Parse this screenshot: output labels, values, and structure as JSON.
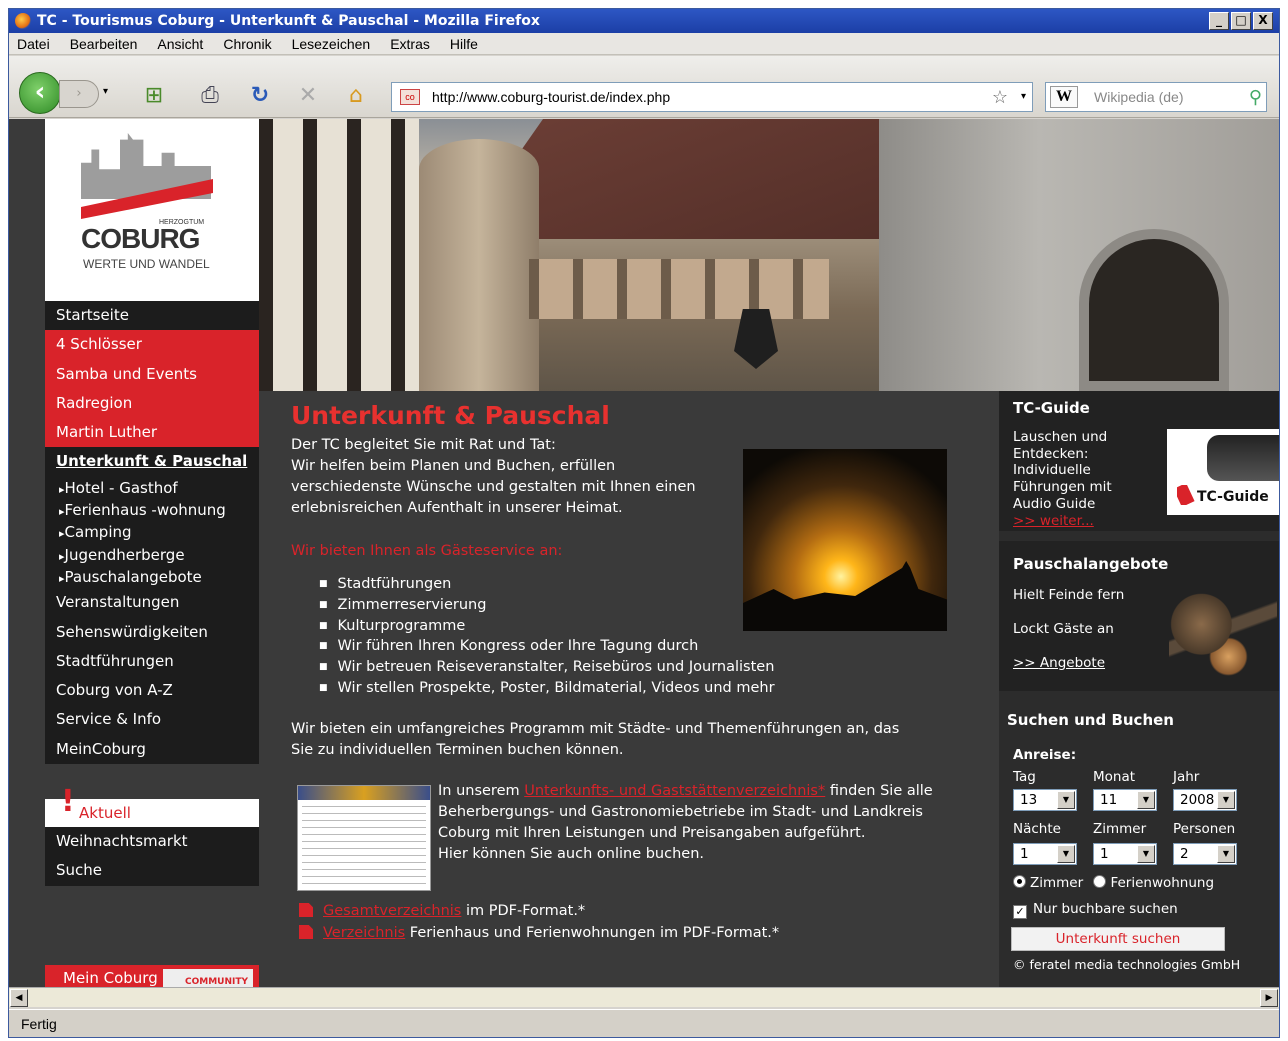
{
  "window": {
    "title": "TC - Tourismus Coburg - Unterkunft & Pauschal - Mozilla Firefox",
    "min": "_",
    "max": "□",
    "close": "X"
  },
  "menu": [
    "Datei",
    "Bearbeiten",
    "Ansicht",
    "Chronik",
    "Lesezeichen",
    "Extras",
    "Hilfe"
  ],
  "toolbar": {
    "url": "http://www.coburg-tourist.de/index.php",
    "search_engine": "W",
    "search_placeholder": "Wikipedia (de)",
    "favicon": "co"
  },
  "logo": {
    "small": "HERZOGTUM",
    "name": "COBURG",
    "tagline": "WERTE UND WANDEL"
  },
  "nav": {
    "top": [
      {
        "label": "Startseite",
        "style": "dark"
      },
      {
        "label": "4 Schlösser",
        "style": "red"
      },
      {
        "label": "Samba und Events",
        "style": "red"
      },
      {
        "label": "Radregion",
        "style": "red"
      },
      {
        "label": "Martin Luther",
        "style": "red"
      },
      {
        "label": "Unterkunft & Pauschal",
        "style": "active"
      }
    ],
    "sub": [
      "Hotel - Gasthof",
      "Ferienhaus -wohnung",
      "Camping",
      "Jugendherberge",
      "Pauschalangebote"
    ],
    "more": [
      "Veranstaltungen",
      "Sehenswürdigkeiten",
      "Stadtführungen",
      "Coburg von A-Z",
      "Service & Info",
      "MeinCoburg"
    ],
    "aktuell": "Aktuell",
    "aktuell_items": [
      "Weihnachtsmarkt",
      "Suche"
    ],
    "mein_coburg": "Mein Coburg",
    "community": "COMMUNITY"
  },
  "main": {
    "title": "Unterkunft & Pauschal",
    "intro": [
      "Der TC begleitet Sie mit Rat und Tat:",
      "Wir helfen beim Planen und Buchen, erfüllen",
      "verschiedenste Wünsche und gestalten mit Ihnen einen",
      "erlebnisreichen Aufenthalt in unserer Heimat."
    ],
    "service_heading": "Wir bieten Ihnen als Gästeservice an:",
    "services": [
      "Stadtführungen",
      "Zimmerreservierung",
      "Kulturprogramme",
      "Wir führen Ihren Kongress oder Ihre Tagung durch",
      "Wir betreuen Reiseveranstalter, Reisebüros und Journalisten",
      "Wir stellen Prospekte, Poster, Bildmaterial, Videos und mehr"
    ],
    "program": [
      "Wir bieten ein umfangreiches Programm mit Städte- und Themenführungen an, das",
      "Sie zu individuellen Terminen buchen können."
    ],
    "dir_pre": "In unserem ",
    "dir_link": "Unterkunfts- und Gaststättenverzeichnis*",
    "dir_post": " finden Sie alle",
    "dir_lines": [
      "Beherbergungs- und Gastronomiebetriebe im Stadt- und Landkreis",
      "Coburg mit Ihren Leistungen und Preisangaben aufgeführt.",
      "Hier können Sie auch online buchen."
    ],
    "pdf1_link": "Gesamtverzeichnis",
    "pdf1_text": " im PDF-Format.*",
    "pdf2_link": "Verzeichnis",
    "pdf2_text": " Ferienhaus und Ferienwohnungen im PDF-Format.*"
  },
  "sidebar": {
    "guide_title": "TC-Guide",
    "guide_text": [
      "Lauschen und",
      "Entdecken:",
      "Individuelle",
      "Führungen mit",
      "Audio Guide"
    ],
    "guide_link": ">> weiter...",
    "guide_img_label": "TC-Guide",
    "pausch_title": "Pauschalangebote",
    "pausch_l1": "Hielt Feinde fern",
    "pausch_l2": "Lockt Gäste an",
    "pausch_link": ">> Angebote",
    "search_title": "Suchen und Buchen",
    "anreise": "Anreise:",
    "tag_label": "Tag",
    "monat_label": "Monat",
    "jahr_label": "Jahr",
    "tag": "13",
    "monat": "11",
    "jahr": "2008",
    "naechte_label": "Nächte",
    "zimmer_label": "Zimmer",
    "personen_label": "Personen",
    "naechte": "1",
    "zimmer": "1",
    "personen": "2",
    "radio_zimmer": "Zimmer",
    "radio_ferien": "Ferienwohnung",
    "checkbox": "Nur buchbare suchen",
    "button": "Unterkunft suchen",
    "copyright": "© feratel media technologies GmbH"
  },
  "status": "Fertig",
  "colors": {
    "accent_red": "#d9232a",
    "page_bg": "#3a3a3a",
    "nav_bg": "#1c1c1c"
  }
}
